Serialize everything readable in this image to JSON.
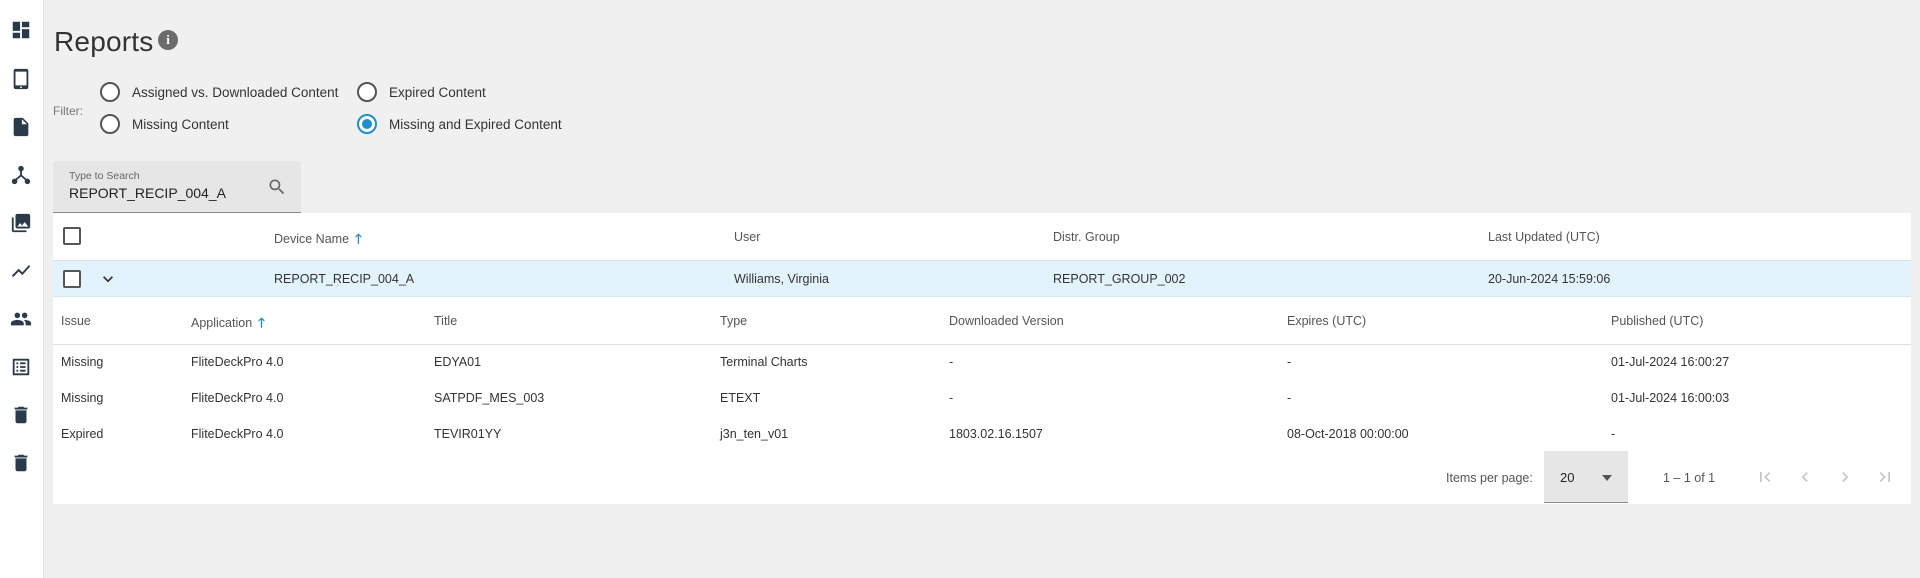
{
  "nav": [
    {
      "icon": "dashboard-icon"
    },
    {
      "icon": "tablet-icon"
    },
    {
      "icon": "document-icon"
    },
    {
      "icon": "hierarchy-icon"
    },
    {
      "icon": "photo-library-icon"
    },
    {
      "icon": "trending-icon"
    },
    {
      "icon": "people-icon"
    },
    {
      "icon": "list-alt-icon"
    },
    {
      "icon": "trash-icon"
    },
    {
      "icon": "trash-icon"
    }
  ],
  "header": {
    "title": "Reports",
    "info_glyph": "i"
  },
  "filter": {
    "label": "Filter:",
    "options": [
      {
        "label": "Assigned vs. Downloaded Content",
        "checked": false
      },
      {
        "label": "Expired Content",
        "checked": false
      },
      {
        "label": "Missing Content",
        "checked": false
      },
      {
        "label": "Missing and Expired Content",
        "checked": true
      }
    ]
  },
  "search": {
    "caption": "Type to Search",
    "value": "REPORT_RECIP_004_A"
  },
  "table": {
    "columns": [
      "Device  Name",
      "User",
      "Distr. Group",
      "Last Updated (UTC)"
    ],
    "sort_arrow": "🡑",
    "rows": [
      {
        "device": "REPORT_RECIP_004_A",
        "user": "Williams, Virginia",
        "group": "REPORT_GROUP_002",
        "updated": "20-Jun-2024 15:59:06"
      }
    ]
  },
  "details": {
    "columns": [
      "Issue",
      "Application",
      "Title",
      "Type",
      "Downloaded Version",
      "Expires (UTC)",
      "Published (UTC)"
    ],
    "rows": [
      {
        "issue": "Missing",
        "app": "FliteDeckPro 4.0",
        "title": "EDYA01",
        "type": "Terminal Charts",
        "version": "-",
        "expires": "-",
        "published": "01-Jul-2024 16:00:27"
      },
      {
        "issue": "Missing",
        "app": "FliteDeckPro 4.0",
        "title": "SATPDF_MES_003",
        "type": "ETEXT",
        "version": "-",
        "expires": "-",
        "published": "01-Jul-2024 16:00:03"
      },
      {
        "issue": "Expired",
        "app": "FliteDeckPro 4.0",
        "title": "TEVIR01YY",
        "type": "j3n_ten_v01",
        "version": "1803.02.16.1507",
        "expires": "08-Oct-2018 00:00:00",
        "published": "-"
      }
    ]
  },
  "paginator": {
    "items_per_page_label": "Items per page:",
    "page_size": "20",
    "range": "1 – 1 of 1"
  },
  "colors": {
    "accent": "#1a8fd4",
    "row_highlight": "#e3f3fc",
    "background": "#f0f0f0"
  }
}
